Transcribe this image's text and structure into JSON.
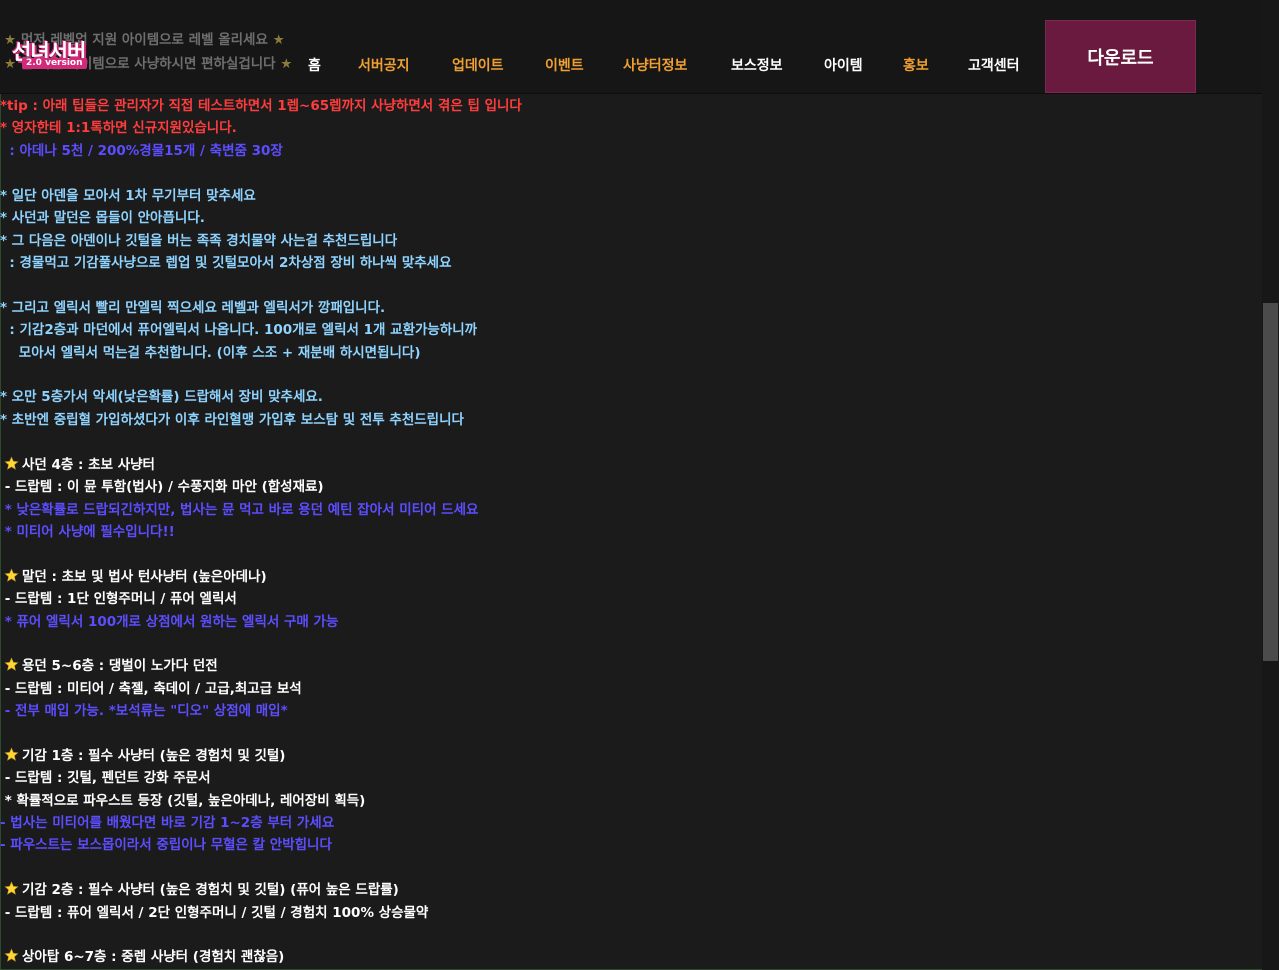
{
  "header": {
    "notices": [
      "먼저 레벨업 지원 아이템으로 레벨 올리세요",
      "몰 지원 아이템으로 사냥하시면 편하실겁니다"
    ],
    "logo": {
      "title": "선녀서버",
      "version": "2.0 version"
    },
    "nav": [
      {
        "label": "홈",
        "color": "#ffffff"
      },
      {
        "label": "서버공지",
        "color": "#f0a030"
      },
      {
        "label": "업데이트",
        "color": "#f0a030"
      },
      {
        "label": "이벤트",
        "color": "#f0a030"
      },
      {
        "label": "사냥터정보",
        "color": "#f0a030"
      },
      {
        "label": "보스정보",
        "color": "#ffffff"
      },
      {
        "label": "아이템",
        "color": "#ffffff"
      },
      {
        "label": "홍보",
        "color": "#f0a030"
      },
      {
        "label": "고객센터",
        "color": "#ffffff"
      }
    ],
    "download_label": "다운로드"
  },
  "colors": {
    "red": "#ff3d3d",
    "blue": "#5c4dff",
    "cyan": "#8fd3ff",
    "white": "#ffffff",
    "orange": "#f0a030",
    "star": "#ffd633"
  },
  "content": {
    "lines": [
      {
        "text": "*tip : 아래 팁들은 관리자가 직접 테스트하면서 1렙~65렙까지 사냥하면서 겪은 팁 입니다",
        "color": "red",
        "star": false
      },
      {
        "text": "* 영자한테 1:1톡하면 신규지원있습니다.",
        "color": "red",
        "star": false
      },
      {
        "text": "  : 아데나 5천 / 200%경물15개 / 축변줌 30장",
        "color": "blue",
        "star": false
      },
      {
        "text": "* 일단 아덴을 모아서 1차 무기부터 맞추세요",
        "color": "cyan",
        "star": false
      },
      {
        "text": "* 사던과 말던은 몹들이 안아픕니다.",
        "color": "cyan",
        "star": false
      },
      {
        "text": "* 그 다음은 아덴이나 깃털을 버는 족족 경치물약 사는걸 추천드립니다",
        "color": "cyan",
        "star": false
      },
      {
        "text": "  : 경물먹고 기감풀사냥으로 렙업 및 깃털모아서 2차상점 장비 하나씩 맞추세요",
        "color": "cyan",
        "star": false
      },
      {
        "text": "* 그리고 엘릭서 빨리 만엘릭 찍으세요 레벨과 엘릭서가 깡패입니다.",
        "color": "cyan",
        "star": false
      },
      {
        "text": "  : 기감2층과 마던에서 퓨어엘릭서 나옵니다. 100개로 엘릭서 1개 교환가능하니까",
        "color": "cyan",
        "star": false
      },
      {
        "text": "    모아서 엘릭서 먹는걸 추천합니다. (이후 스조 + 재분배 하시면됩니다)",
        "color": "cyan",
        "star": false
      },
      {
        "text": "* 오만 5층가서 악세(낮은확률) 드랍해서 장비 맞추세요.",
        "color": "cyan",
        "star": false
      },
      {
        "text": "* 초반엔 중립혈 가입하셨다가 이후 라인혈맹 가입후 보스탐 및 전투 추천드립니다",
        "color": "cyan",
        "star": false
      },
      {
        "text": "사던 4층 : 초보 사냥터",
        "color": "white",
        "star": true
      },
      {
        "text": " - 드랍템 : 이 뮨 투함(법사) / 수풍지화 마안 (합성재료)",
        "color": "white",
        "star": false
      },
      {
        "text": " * 낮은확률로 드랍되긴하지만, 법사는 뮨 먹고 바로 용던 예틴 잡아서 미티어 드세요",
        "color": "blue",
        "star": false
      },
      {
        "text": " * 미티어 사냥에 필수입니다!!",
        "color": "blue",
        "star": false
      },
      {
        "text": "말던 : 초보 및 법사 턴사냥터 (높은아데나)",
        "color": "white",
        "star": true
      },
      {
        "text": " - 드랍템 : 1단 인형주머니 / 퓨어 엘릭서",
        "color": "white",
        "star": false
      },
      {
        "text": " * 퓨어 엘릭서 100개로 상점에서 원하는 엘릭서 구매 가능",
        "color": "blue",
        "star": false
      },
      {
        "text": "용던 5~6층 : 댕벌이 노가다 던전",
        "color": "white",
        "star": true
      },
      {
        "text": " - 드랍템 : 미티어 / 축젤, 축데이 / 고급,최고급 보석",
        "color": "white",
        "star": false
      },
      {
        "text": " - 전부 매입 가능. *보석류는 \"디오\" 상점에 매입*",
        "color": "blue",
        "star": false
      },
      {
        "text": "기감 1층 : 필수 사냥터 (높은 경험치 및 깃털)",
        "color": "white",
        "star": true
      },
      {
        "text": " - 드랍템 : 깃털, 펜던트 강화 주문서",
        "color": "white",
        "star": false
      },
      {
        "text": " * 확률적으로 파우스트 등장 (깃털, 높은아데나, 레어장비 획득)",
        "color": "white",
        "star": false
      },
      {
        "text": "- 법사는 미티어를 배웠다면 바로 기감 1~2층 부터 가세요",
        "color": "blue",
        "star": false
      },
      {
        "text": "- 파우스트는 보스몹이라서 중립이나 무혈은 칼 안박힙니다",
        "color": "blue",
        "star": false
      },
      {
        "text": "기감 2층 : 필수 사냥터 (높은 경험치 및 깃털) (퓨어 높은 드랍률)",
        "color": "white",
        "star": true
      },
      {
        "text": " - 드랍템 : 퓨어 엘릭서 / 2단 인형주머니 / 깃털 / 경험치 100% 상승물약",
        "color": "white",
        "star": false
      },
      {
        "text": "상아탑 6~7층 : 중렙 사냥터 (경험치 괜찮음)",
        "color": "white",
        "star": true
      }
    ]
  }
}
